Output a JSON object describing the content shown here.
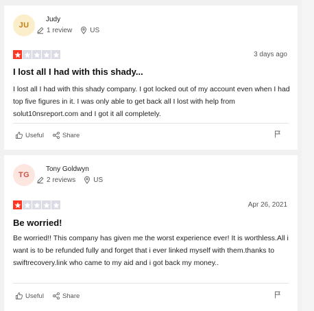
{
  "colors": {
    "star_red": "#ff3722",
    "star_empty": "#dcdce6",
    "avatar1_bg": "#fbeecb",
    "avatar1_fg": "#c37e17",
    "avatar2_bg": "#fde6e0",
    "avatar2_fg": "#c8554a"
  },
  "reviews": [
    {
      "initials": "JU",
      "name": "Judy",
      "review_count": "1 review",
      "country": "US",
      "rating": 1,
      "date": "3 days ago",
      "title": "I lost all I had with this shady...",
      "body": "I lost all I had with this shady company. I got locked out of my account even when I had top five figures in it. I was only able to get back all I lost with help from solut10nsreport.com and I got it all completely.",
      "useful_label": "Useful",
      "share_label": "Share"
    },
    {
      "initials": "TG",
      "name": "Tony Goldwyn",
      "review_count": "2 reviews",
      "country": "US",
      "rating": 1,
      "date": "Apr 26, 2021",
      "title": "Be worried!",
      "body": "Be worried!! This company has given me the worst experience ever! It is worthless.All i want is to be refunded fully and forget that i ever linked myself with them.thanks to swiftrecovery.link who came to my aid and i got back my money..",
      "useful_label": "Useful",
      "share_label": "Share"
    }
  ]
}
